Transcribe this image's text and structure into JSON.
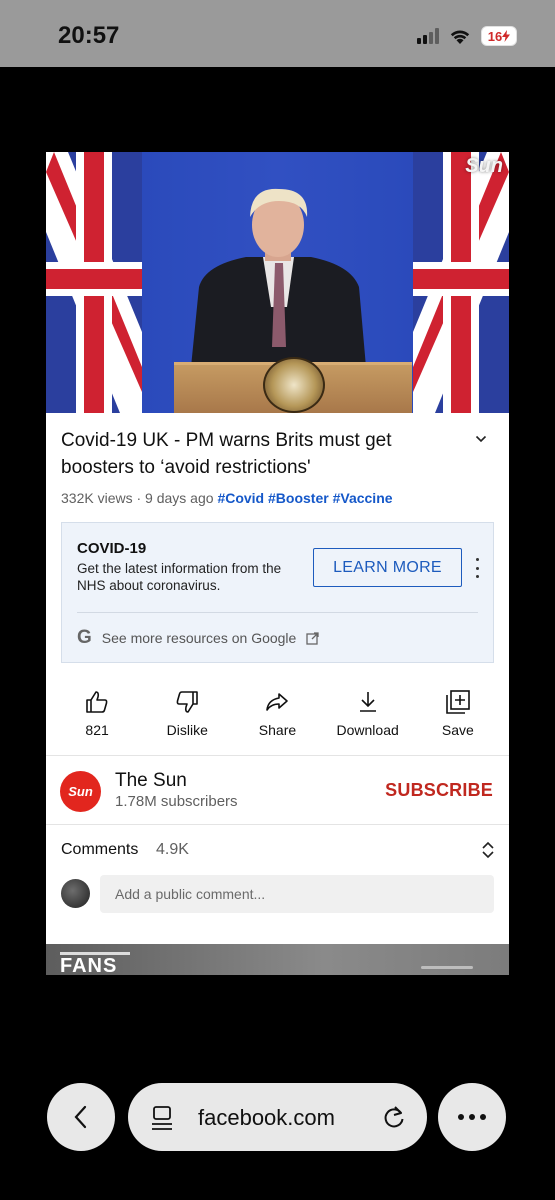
{
  "status_bar": {
    "time": "20:57",
    "battery": "16"
  },
  "video": {
    "watermark": "Sun"
  },
  "video_info": {
    "title": "Covid-19 UK - PM warns Brits must get boosters to ‘avoid restrictions'",
    "views": "332K views",
    "age": "9 days ago",
    "hashtags": [
      "#Covid",
      "#Booster",
      "#Vaccine"
    ]
  },
  "info_panel": {
    "title": "COVID-19",
    "body": "Get the latest information from the NHS about coronavirus.",
    "button_label": "LEARN MORE",
    "google_link": "See more resources on Google"
  },
  "actions": {
    "like": "821",
    "dislike": "Dislike",
    "share": "Share",
    "download": "Download",
    "save": "Save"
  },
  "channel": {
    "logo_text": "Sun",
    "name": "The Sun",
    "subscribers": "1.78M subscribers",
    "subscribe_label": "SUBSCRIBE"
  },
  "comments": {
    "label": "Comments",
    "count": "4.9K",
    "placeholder": "Add a public comment..."
  },
  "next_video": {
    "text": "FANS"
  },
  "browser": {
    "url": "facebook.com"
  },
  "colors": {
    "accent_blue": "#1d5bbd",
    "subscribe_red": "#c0281f",
    "hashtag_blue": "#1558c9"
  }
}
